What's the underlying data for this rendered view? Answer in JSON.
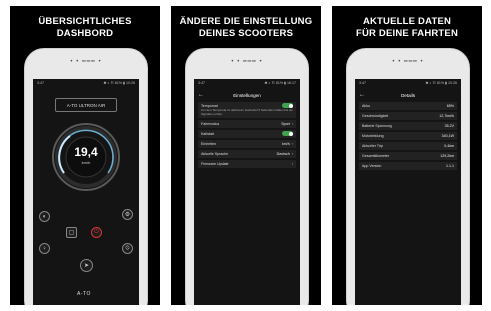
{
  "panels": [
    {
      "headline": [
        "ÜBERSICHTLICHES",
        "DASHBORD"
      ],
      "status_left": "3:47",
      "status_right": "✱ ◐ ☷ 81% ▮ 10:26",
      "device_name": "A-TO ULTRON AIR",
      "speed": "19,4",
      "speed_unit": "km/h",
      "logo": "A-TO"
    },
    {
      "headline": [
        "ÄNDERE DIE EINSTELLUNG",
        "DEINES SCOOTERS"
      ],
      "status_left": "3:47",
      "status_right": "✱ ◐ ☷ 81% ▮ 16:17",
      "title": "Einstellungen",
      "rows": [
        {
          "label": "Tempomat",
          "sub": "Um den Tempomat zu aktivieren Gashebel 5 Sekunden halten bis ein Signalton ertönt",
          "value": "",
          "toggle": true
        },
        {
          "label": "Fahrmodus",
          "value": "Sport",
          "chevron": true
        },
        {
          "label": "Kaltstart",
          "value": "",
          "toggle": true
        },
        {
          "label": "Einheiten",
          "value": "km/h",
          "chevron": true
        },
        {
          "label": "Aktuelle Sprache",
          "value": "Deutsch",
          "chevron": true
        },
        {
          "label": "Firmware Update",
          "value": "",
          "chevron": true
        }
      ]
    },
    {
      "headline": [
        "AKTUELLE DATEN",
        "FÜR DEINE FAHRTEN"
      ],
      "status_left": "3:47",
      "status_right": "✱ ◐ ☷ 81% ▮ 10:26",
      "title": "Details",
      "rows": [
        {
          "label": "Akku",
          "value": "65%"
        },
        {
          "label": "Geschwindigkeit",
          "value": "12,7km/h"
        },
        {
          "label": "Batterie Spannung",
          "value": "35.2V"
        },
        {
          "label": "Motorleistung",
          "value": "340,1W"
        },
        {
          "label": "Aktueller Trip",
          "value": "0,4km"
        },
        {
          "label": "Gesamtkilometer",
          "value": "129,2km"
        },
        {
          "label": "App Version",
          "value": "1.1.1"
        }
      ]
    }
  ]
}
